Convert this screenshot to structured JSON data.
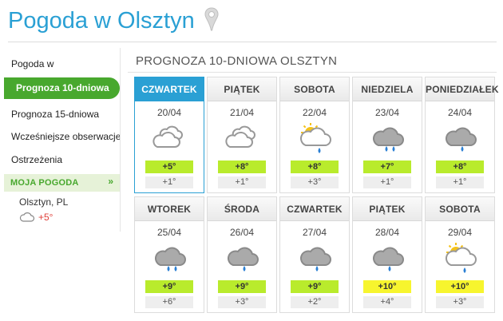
{
  "header": {
    "title": "Pogoda w Olsztyn",
    "pin_icon": "location-pin-icon"
  },
  "sidebar": {
    "items": [
      {
        "label": "Pogoda w",
        "active": false
      },
      {
        "label": "Prognoza 10-dniowa",
        "active": true
      },
      {
        "label": "Prognoza 15-dniowa",
        "active": false
      },
      {
        "label": "Wcześniejsze obserwacje",
        "active": false
      },
      {
        "label": "Ostrzeżenia",
        "active": false
      }
    ],
    "moja_pogoda": {
      "label": "MOJA POGODA",
      "chevron_icon": "double-chevron-down-icon",
      "city": "Olsztyn, PL",
      "city_icon": "cloud-icon",
      "city_temp": "+5°"
    }
  },
  "content": {
    "title": "PROGNOZA 10-DNIOWA OLSZTYN"
  },
  "colors": {
    "brand_blue": "#2aa0d4",
    "active_green": "#48a82e",
    "temp_green": "#b9eb2c",
    "temp_yellow": "#f7f52e",
    "temp_red": "#e0403a"
  },
  "days": [
    {
      "day": "CZWARTEK",
      "date": "20/04",
      "icon": "cloudy-icon",
      "max": "+5°",
      "min": "+1°",
      "max_color": "green",
      "active": true
    },
    {
      "day": "PIĄTEK",
      "date": "21/04",
      "icon": "cloudy-icon",
      "max": "+8°",
      "min": "+1°",
      "max_color": "green",
      "active": false
    },
    {
      "day": "SOBOTA",
      "date": "22/04",
      "icon": "sun-cloud-rain-icon",
      "max": "+8°",
      "min": "+3°",
      "max_color": "green",
      "active": false
    },
    {
      "day": "NIEDZIELA",
      "date": "23/04",
      "icon": "cloud-heavy-rain-icon",
      "max": "+7°",
      "min": "+1°",
      "max_color": "green",
      "active": false
    },
    {
      "day": "PONIEDZIAŁEK",
      "date": "24/04",
      "icon": "cloud-rain-icon",
      "max": "+8°",
      "min": "+1°",
      "max_color": "green",
      "active": false
    },
    {
      "day": "WTOREK",
      "date": "25/04",
      "icon": "cloud-heavy-rain-icon",
      "max": "+9°",
      "min": "+6°",
      "max_color": "green",
      "active": false
    },
    {
      "day": "ŚRODA",
      "date": "26/04",
      "icon": "cloud-rain-icon",
      "max": "+9°",
      "min": "+3°",
      "max_color": "green",
      "active": false
    },
    {
      "day": "CZWARTEK",
      "date": "27/04",
      "icon": "cloud-rain-icon",
      "max": "+9°",
      "min": "+2°",
      "max_color": "green",
      "active": false
    },
    {
      "day": "PIĄTEK",
      "date": "28/04",
      "icon": "cloud-rain-icon",
      "max": "+10°",
      "min": "+4°",
      "max_color": "yellow",
      "active": false
    },
    {
      "day": "SOBOTA",
      "date": "29/04",
      "icon": "sun-cloud-rain-icon",
      "max": "+10°",
      "min": "+3°",
      "max_color": "yellow",
      "active": false
    }
  ]
}
